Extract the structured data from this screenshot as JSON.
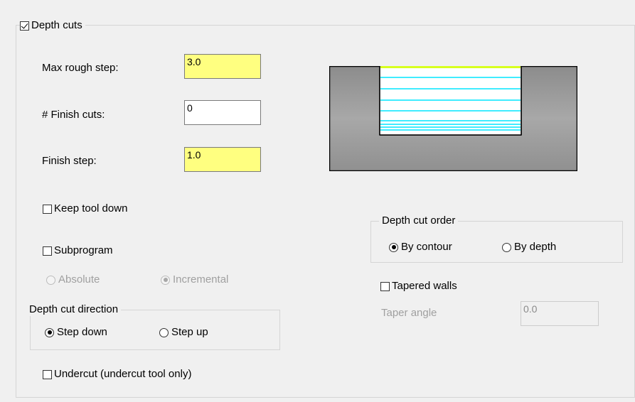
{
  "depth_cuts": {
    "title": "Depth cuts",
    "max_rough_step": {
      "label": "Max rough step:",
      "value": "3.0"
    },
    "finish_cuts": {
      "label": "# Finish cuts:",
      "value": "0"
    },
    "finish_step": {
      "label": "Finish step:",
      "value": "1.0"
    },
    "keep_tool_down": "Keep tool down",
    "subprogram": "Subprogram",
    "absolute": "Absolute",
    "incremental": "Incremental",
    "direction": {
      "title": "Depth cut direction",
      "step_down": "Step down",
      "step_up": "Step up"
    },
    "undercut": "Undercut (undercut tool only)",
    "order": {
      "title": "Depth cut order",
      "by_contour": "By contour",
      "by_depth": "By depth"
    },
    "tapered_walls": "Tapered walls",
    "taper_angle": {
      "label": "Taper angle",
      "value": "0.0"
    }
  },
  "colors": {
    "highlight_field": "#ffff80",
    "cut_lines": "#00e5ff",
    "top_line": "#d7ff1e",
    "material": "#9a9a9a"
  }
}
